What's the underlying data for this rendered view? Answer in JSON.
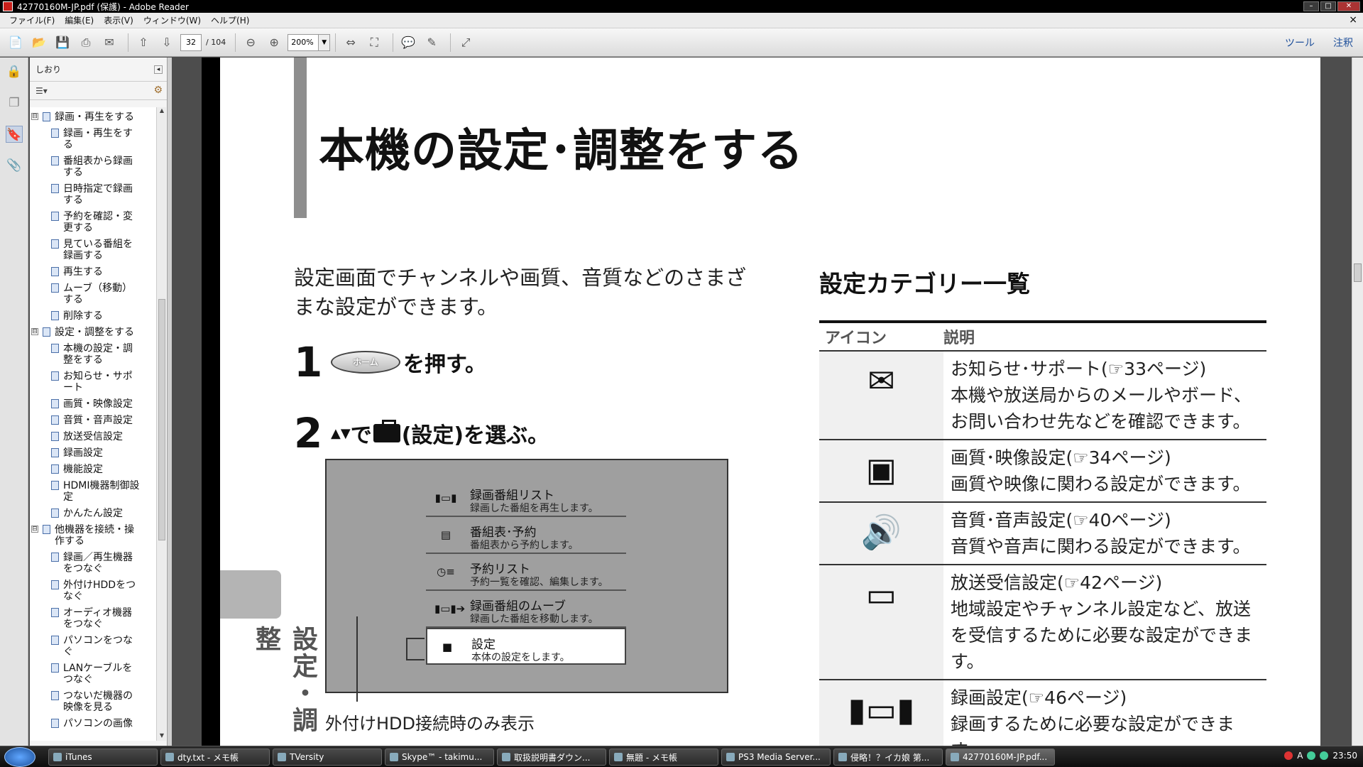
{
  "window": {
    "title": "42770160M-JP.pdf (保護) - Adobe Reader",
    "doc_close": "×"
  },
  "menu": [
    "ファイル(F)",
    "編集(E)",
    "表示(V)",
    "ウィンドウ(W)",
    "ヘルプ(H)"
  ],
  "toolbar": {
    "page_current": "32",
    "page_total": "/ 104",
    "zoom": "200%",
    "tools_label": "ツール",
    "comment_label": "注釈"
  },
  "bookmarks": {
    "header": "しおり",
    "collapse": "◂",
    "options": "☰▾",
    "items": [
      {
        "label": "録画・再生をする",
        "level": 0,
        "toggle": "⊟"
      },
      {
        "label": "録画・再生をする",
        "level": 1
      },
      {
        "label": "番組表から録画する",
        "level": 1
      },
      {
        "label": "日時指定で録画する",
        "level": 1
      },
      {
        "label": "予約を確認・変更する",
        "level": 1
      },
      {
        "label": "見ている番組を録画する",
        "level": 1
      },
      {
        "label": "再生する",
        "level": 1
      },
      {
        "label": "ムーブ（移動）する",
        "level": 1
      },
      {
        "label": "削除する",
        "level": 1
      },
      {
        "label": "設定・調整をする",
        "level": 0,
        "toggle": "⊟"
      },
      {
        "label": "本機の設定・調整をする",
        "level": 1
      },
      {
        "label": "お知らせ・サポート",
        "level": 1
      },
      {
        "label": "画質・映像設定",
        "level": 1
      },
      {
        "label": "音質・音声設定",
        "level": 1
      },
      {
        "label": "放送受信設定",
        "level": 1
      },
      {
        "label": "録画設定",
        "level": 1
      },
      {
        "label": "機能設定",
        "level": 1
      },
      {
        "label": "HDMI機器制御設定",
        "level": 1
      },
      {
        "label": "かんたん設定",
        "level": 1
      },
      {
        "label": "他機器を接続・操作する",
        "level": 0,
        "toggle": "⊟"
      },
      {
        "label": "録画／再生機器をつなぐ",
        "level": 1
      },
      {
        "label": "外付けHDDをつなぐ",
        "level": 1
      },
      {
        "label": "オーディオ機器をつなぐ",
        "level": 1
      },
      {
        "label": "パソコンをつなぐ",
        "level": 1
      },
      {
        "label": "LANケーブルをつなぐ",
        "level": 1
      },
      {
        "label": "つないだ機器の映像を見る",
        "level": 1
      },
      {
        "label": "パソコンの画像",
        "level": 1
      }
    ]
  },
  "page": {
    "title": "本機の設定･調整をする",
    "intro": "設定画面でチャンネルや画質、音質などのさまざまな設定ができます。",
    "step1": {
      "num": "1",
      "home_label": "ホーム",
      "text": "を押す。"
    },
    "step2": {
      "num": "2",
      "arrows": "▲▼",
      "de": "で",
      "text": "(設定)を選ぶ。"
    },
    "menu_items": [
      {
        "icon": "▮▭▮",
        "title": "録画番組リスト",
        "sub": "録画した番組を再生します。"
      },
      {
        "icon": "▤",
        "title": "番組表･予約",
        "sub": "番組表から予約します。"
      },
      {
        "icon": "◷≡",
        "title": "予約リスト",
        "sub": "予約一覧を確認、編集します。"
      },
      {
        "icon": "▮▭▮➔",
        "title": "録画番組のムーブ",
        "sub": "録画した番組を移動します。"
      },
      {
        "icon": "■",
        "title": "設定",
        "sub": "本体の設定をします。"
      }
    ],
    "callout": "外付けHDD接続時のみ表示",
    "side_label": "設定・調整",
    "category": {
      "title": "設定カテゴリー一覧",
      "head_icon": "アイコン",
      "head_desc": "説明",
      "rows": [
        {
          "icon": "✉",
          "title": "お知らせ･サポート(☞33ページ)",
          "desc": "本機や放送局からのメールやボード、お問い合わせ先などを確認できます。"
        },
        {
          "icon": "▣",
          "title": "画質･映像設定(☞34ページ)",
          "desc": "画質や映像に関わる設定ができます。"
        },
        {
          "icon": "🔊",
          "title": "音質･音声設定(☞40ページ)",
          "desc": "音質や音声に関わる設定ができます。"
        },
        {
          "icon": "▭",
          "title": "放送受信設定(☞42ページ)",
          "desc": "地域設定やチャンネル設定など、放送を受信するために必要な設定ができます。"
        },
        {
          "icon": "▮▭▮",
          "title": "録画設定(☞46ページ)",
          "desc": "録画するために必要な設定ができます。"
        }
      ]
    }
  },
  "taskbar": {
    "items": [
      "iTunes",
      "dty.txt - メモ帳",
      "TVersity",
      "Skype™ - takimu...",
      "取扱説明書ダウン...",
      "無題 - メモ帳",
      "PS3 Media Server...",
      "侵略！？イカ娘 第...",
      "42770160M-JP.pdf..."
    ],
    "clock": "23:50",
    "ime": "A"
  }
}
